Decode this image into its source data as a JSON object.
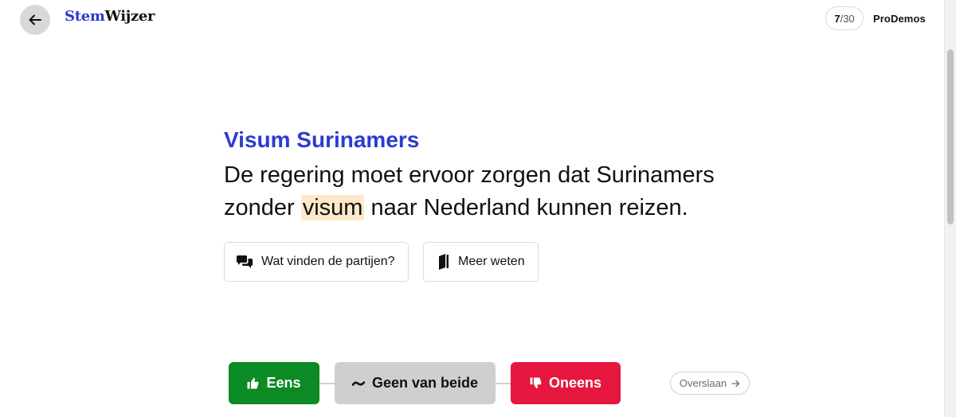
{
  "header": {
    "back_icon": "arrow-left-icon",
    "logo_part1": "Stem",
    "logo_part2": "Wijzer",
    "progress_current": "7",
    "progress_total": "/30",
    "org": "ProDemos"
  },
  "question": {
    "topic": "Visum Surinamers",
    "statement_before": "De regering moet ervoor zorgen dat Surinamers zonder ",
    "statement_highlight": "visum",
    "statement_after": " naar Nederland kunnen reizen."
  },
  "info_buttons": {
    "parties_label": "Wat vinden de partijen?",
    "parties_icon": "chat-bubbles-icon",
    "more_label": "Meer weten",
    "more_icon": "book-icon"
  },
  "vote": {
    "agree_label": "Eens",
    "neither_label": "Geen van beide",
    "disagree_label": "Oneens",
    "skip_label": "Overslaan"
  },
  "colors": {
    "brand_blue": "#2c3bd0",
    "agree_green": "#0c8a23",
    "disagree_red": "#e5173f",
    "neutral_grey": "#cfcfcf",
    "highlight": "#fde9c9"
  }
}
